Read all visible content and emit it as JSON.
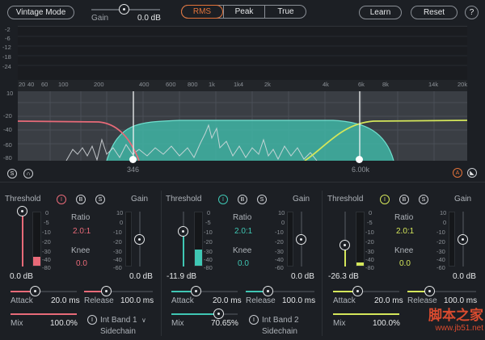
{
  "header": {
    "vintage_mode": "Vintage Mode",
    "gain_label": "Gain",
    "gain_value": "0.0 dB",
    "detect_modes": [
      "RMS",
      "Peak",
      "True"
    ],
    "active_mode": "RMS",
    "learn": "Learn",
    "reset": "Reset",
    "help": "?"
  },
  "spectrum": {
    "db_top": [
      "-2",
      "-6",
      "-12",
      "-18",
      "-24"
    ],
    "freq_labels": [
      "20",
      "40",
      "60",
      "100",
      "200",
      "400",
      "600",
      "800",
      "1k",
      "1k4",
      "2k",
      "4k",
      "6k",
      "8k",
      "14k",
      "20k"
    ],
    "db_bottom": [
      "10",
      "-20",
      "-40",
      "-60",
      "-80"
    ],
    "crossover1": "346",
    "crossover2": "6.00k"
  },
  "bands": [
    {
      "threshold_label": "Threshold",
      "gain_label": "Gain",
      "ratio_label": "Ratio",
      "ratio": "2.0:1",
      "knee_label": "Knee",
      "knee": "0.0",
      "threshold_value": "0.0 dB",
      "gain_value": "0.0 dB",
      "attack_label": "Attack",
      "attack": "20.0 ms",
      "release_label": "Release",
      "release": "100.0 ms",
      "mix_label": "Mix",
      "mix": "100.0%",
      "sidechain_source": "Int Band 1",
      "sidechain_label": "Sidechain",
      "color": "#e86a78"
    },
    {
      "threshold_label": "Threshold",
      "gain_label": "Gain",
      "ratio_label": "Ratio",
      "ratio": "2.0:1",
      "knee_label": "Knee",
      "knee": "0.0",
      "threshold_value": "-11.9 dB",
      "gain_value": "0.0 dB",
      "attack_label": "Attack",
      "attack": "20.0 ms",
      "release_label": "Release",
      "release": "100.0 ms",
      "mix_label": "Mix",
      "mix": "70.65%",
      "sidechain_source": "Int Band 2",
      "sidechain_label": "Sidechain",
      "color": "#3fc7b4"
    },
    {
      "threshold_label": "Threshold",
      "gain_label": "Gain",
      "ratio_label": "Ratio",
      "ratio": "2.0:1",
      "knee_label": "Knee",
      "knee": "0.0",
      "threshold_value": "-26.3 dB",
      "gain_value": "0.0 dB",
      "attack_label": "Attack",
      "attack": "20.0 ms",
      "release_label": "Release",
      "release": "100.0 ms",
      "mix_label": "Mix",
      "mix": "100.0%",
      "color": "#d4e65a"
    }
  ],
  "meter_scale": [
    "0",
    "-5",
    "-10",
    "-20",
    "-30",
    "-40",
    "-80"
  ],
  "gain_scale": [
    "10",
    "0",
    "-10",
    "-20",
    "-30",
    "-40",
    "-60"
  ],
  "watermark": {
    "line1": "脚本之家",
    "line2": "www.jb51.net"
  }
}
